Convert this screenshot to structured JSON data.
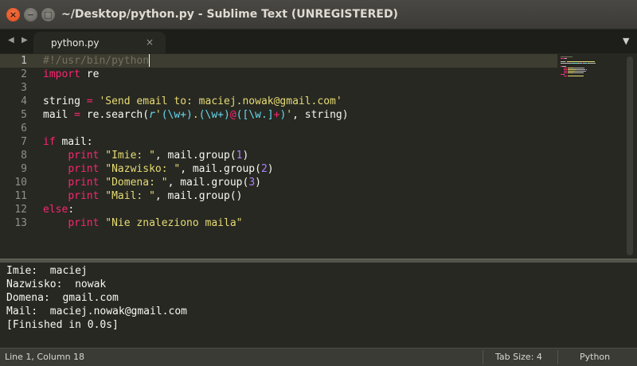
{
  "window": {
    "title": "~/Desktop/python.py - Sublime Text (UNREGISTERED)",
    "close_glyph": "×",
    "minimize_glyph": "−",
    "maximize_glyph": "□"
  },
  "tabbar": {
    "nav_left_glyph": "◀",
    "nav_right_glyph": "▶",
    "tabs": [
      {
        "label": "python.py",
        "close_glyph": "×",
        "active": true
      }
    ],
    "dropdown_glyph": "▼"
  },
  "editor": {
    "line_numbers": [
      "1",
      "2",
      "3",
      "4",
      "5",
      "6",
      "7",
      "8",
      "9",
      "10",
      "11",
      "12",
      "13"
    ],
    "active_line": 1,
    "lines": [
      [
        {
          "t": "#!/usr/bin/python",
          "c": "comment"
        }
      ],
      [
        {
          "t": "import",
          "c": "kw"
        },
        {
          "t": " re",
          "c": "plain"
        }
      ],
      [],
      [
        {
          "t": "string ",
          "c": "plain"
        },
        {
          "t": "=",
          "c": "kw"
        },
        {
          "t": " ",
          "c": "plain"
        },
        {
          "t": "'Send email to: maciej.nowak@gmail.com'",
          "c": "str"
        }
      ],
      [
        {
          "t": "mail ",
          "c": "plain"
        },
        {
          "t": "=",
          "c": "kw"
        },
        {
          "t": " re.search(",
          "c": "plain"
        },
        {
          "t": "r",
          "c": "it"
        },
        {
          "t": "'",
          "c": "str"
        },
        {
          "t": "(\\w+)",
          "c": "re"
        },
        {
          "t": ".",
          "c": "str"
        },
        {
          "t": "(\\w+)",
          "c": "re"
        },
        {
          "t": "@",
          "c": "kw"
        },
        {
          "t": "(",
          "c": "re"
        },
        {
          "t": "[\\w.]",
          "c": "re"
        },
        {
          "t": "+",
          "c": "kw"
        },
        {
          "t": ")",
          "c": "re"
        },
        {
          "t": "'",
          "c": "str"
        },
        {
          "t": ", string)",
          "c": "plain"
        }
      ],
      [],
      [
        {
          "t": "if",
          "c": "kw"
        },
        {
          "t": " mail:",
          "c": "plain"
        }
      ],
      [
        {
          "t": "    ",
          "c": "plain"
        },
        {
          "t": "print",
          "c": "kw"
        },
        {
          "t": " ",
          "c": "plain"
        },
        {
          "t": "\"Imie: \"",
          "c": "str"
        },
        {
          "t": ", mail.group(",
          "c": "plain"
        },
        {
          "t": "1",
          "c": "num"
        },
        {
          "t": ")",
          "c": "plain"
        }
      ],
      [
        {
          "t": "    ",
          "c": "plain"
        },
        {
          "t": "print",
          "c": "kw"
        },
        {
          "t": " ",
          "c": "plain"
        },
        {
          "t": "\"Nazwisko: \"",
          "c": "str"
        },
        {
          "t": ", mail.group(",
          "c": "plain"
        },
        {
          "t": "2",
          "c": "num"
        },
        {
          "t": ")",
          "c": "plain"
        }
      ],
      [
        {
          "t": "    ",
          "c": "plain"
        },
        {
          "t": "print",
          "c": "kw"
        },
        {
          "t": " ",
          "c": "plain"
        },
        {
          "t": "\"Domena: \"",
          "c": "str"
        },
        {
          "t": ", mail.group(",
          "c": "plain"
        },
        {
          "t": "3",
          "c": "num"
        },
        {
          "t": ")",
          "c": "plain"
        }
      ],
      [
        {
          "t": "    ",
          "c": "plain"
        },
        {
          "t": "print",
          "c": "kw"
        },
        {
          "t": " ",
          "c": "plain"
        },
        {
          "t": "\"Mail: \"",
          "c": "str"
        },
        {
          "t": ", mail.group()",
          "c": "plain"
        }
      ],
      [
        {
          "t": "else",
          "c": "kw"
        },
        {
          "t": ":",
          "c": "plain"
        }
      ],
      [
        {
          "t": "    ",
          "c": "plain"
        },
        {
          "t": "print",
          "c": "kw"
        },
        {
          "t": " ",
          "c": "plain"
        },
        {
          "t": "\"Nie znaleziono maila\"",
          "c": "str"
        }
      ]
    ],
    "colors": {
      "background": "#272822",
      "plain": "#f8f8f2",
      "comment": "#75715e",
      "keyword": "#f92672",
      "string": "#e6db74",
      "number": "#ae81ff",
      "regex": "#66d9ef"
    }
  },
  "output": {
    "lines": [
      "Imie:  maciej",
      "Nazwisko:  nowak",
      "Domena:  gmail.com",
      "Mail:  maciej.nowak@gmail.com",
      "[Finished in 0.0s]"
    ]
  },
  "statusbar": {
    "position": "Line 1, Column 18",
    "tab_size": "Tab Size: 4",
    "syntax": "Python"
  }
}
